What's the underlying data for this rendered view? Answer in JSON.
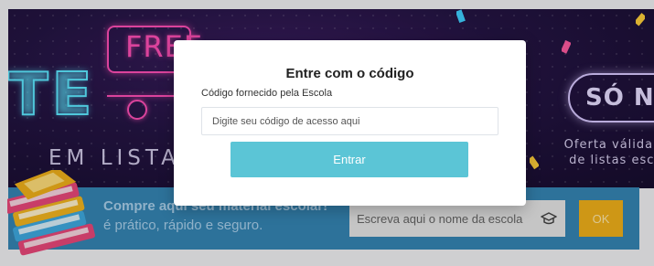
{
  "banner": {
    "headline_fragment": "TE",
    "free_sign": "FREE",
    "em_listas": "EM LISTAS",
    "so_nesta": "SÓ NESTA",
    "oferta_line1": "Oferta válida até",
    "oferta_line2": "de listas escola"
  },
  "search_strip": {
    "title": "Compre aqui seu material escolar!",
    "subtitle": "é prático, rápido e seguro.",
    "school_placeholder": "Escreva aqui o nome da escola",
    "ok_label": "OK"
  },
  "modal": {
    "title": "Entre com o código",
    "field_label": "Código fornecido pela Escola",
    "field_placeholder": "Digite seu código de acesso aqui",
    "submit_label": "Entrar"
  },
  "colors": {
    "strip_blue": "#3585b4",
    "button_teal": "#5bc5d6",
    "ok_yellow": "#f0b01a",
    "neon_cyan": "#5ce8ff",
    "neon_pink": "#ff4fb6"
  }
}
